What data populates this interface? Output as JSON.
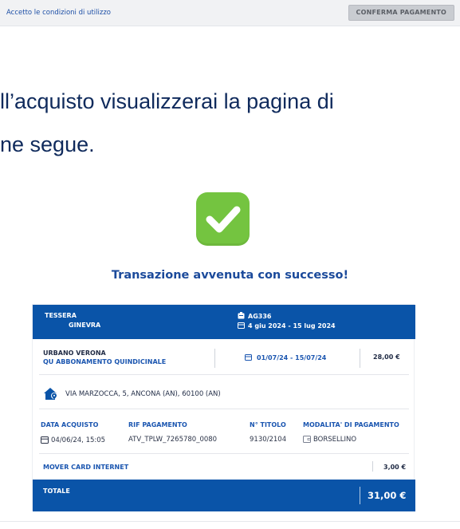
{
  "topbar": {
    "terms_label": "Accetto le condizioni di utilizzo",
    "confirm_label": "CONFERMA PAGAMENTO"
  },
  "intro": {
    "line1": "ll’acquisto visualizzerai la pagina di",
    "line2": "ne segue."
  },
  "success_message": "Transazione avvenuta con successo!",
  "receipt": {
    "header": {
      "card_label": "TESSERA",
      "card_name": "GINEVRA",
      "card_code": "AG336",
      "validity": "4 giu 2024 - 15 lug 2024"
    },
    "service": {
      "name": "URBANO VERONA",
      "subscription": "QU ABBONAMENTO QUINDICINALE",
      "period": "01/07/24 - 15/07/24",
      "price": "28,00 €"
    },
    "address": "VIA MARZOCCA, 5, ANCONA (AN), 60100 (AN)",
    "details": {
      "purchase_date_label": "DATA ACQUISTO",
      "purchase_date": "04/06/24, 15:05",
      "payment_ref_label": "RIF PAGAMENTO",
      "payment_ref": "ATV_TPLW_7265780_0080",
      "title_no_label": "N° TITOLO",
      "title_no": "9130/2104",
      "payment_method_label": "MODALITA' DI PAGAMENTO",
      "payment_method": "BORSELLINO"
    },
    "fee": {
      "label": "MOVER CARD INTERNET",
      "price": "3,00 €"
    },
    "total": {
      "label": "TOTALE",
      "value": "31,00 €"
    }
  },
  "colors": {
    "primary_blue": "#0a54a8",
    "link_blue": "#1b56b0",
    "success_green": "#74c440"
  }
}
